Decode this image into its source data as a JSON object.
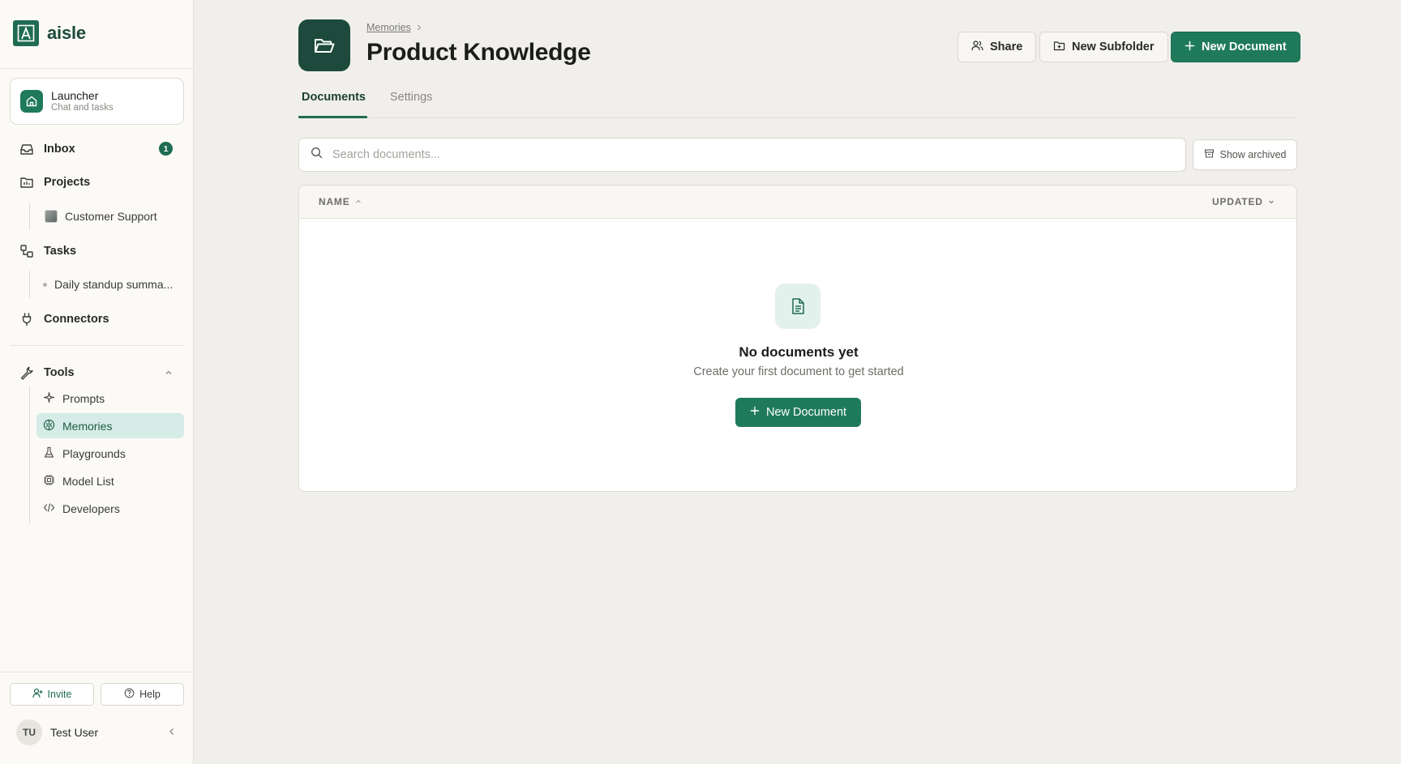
{
  "app": {
    "name": "aisle"
  },
  "sidebar": {
    "launcher": {
      "title": "Launcher",
      "subtitle": "Chat and tasks"
    },
    "inbox": {
      "label": "Inbox",
      "badge": "1"
    },
    "projects": {
      "label": "Projects",
      "items": [
        {
          "label": "Customer Support"
        }
      ]
    },
    "tasks": {
      "label": "Tasks",
      "items": [
        {
          "label": "Daily standup summa..."
        }
      ]
    },
    "connectors": {
      "label": "Connectors"
    },
    "tools": {
      "label": "Tools",
      "items": [
        {
          "label": "Prompts",
          "icon": "sparkle-icon"
        },
        {
          "label": "Memories",
          "icon": "brain-icon",
          "active": true
        },
        {
          "label": "Playgrounds",
          "icon": "flask-icon"
        },
        {
          "label": "Model List",
          "icon": "chip-icon"
        },
        {
          "label": "Developers",
          "icon": "code-icon"
        }
      ]
    },
    "invite_label": "Invite",
    "help_label": "Help",
    "user": {
      "initials": "TU",
      "name": "Test User"
    }
  },
  "header": {
    "breadcrumb": "Memories",
    "title": "Product Knowledge",
    "share_label": "Share",
    "new_subfolder_label": "New Subfolder",
    "new_document_label": "New Document"
  },
  "tabs": [
    {
      "label": "Documents",
      "active": true
    },
    {
      "label": "Settings",
      "active": false
    }
  ],
  "search": {
    "placeholder": "Search documents...",
    "value": ""
  },
  "show_archived_label": "Show archived",
  "table": {
    "columns": [
      {
        "label": "NAME",
        "sort": "asc"
      },
      {
        "label": "UPDATED",
        "sort": "desc"
      }
    ],
    "rows": []
  },
  "empty_state": {
    "title": "No documents yet",
    "subtitle": "Create your first document to get started",
    "button_label": "New Document"
  },
  "colors": {
    "accent": "#1f7a5c",
    "brand_dark": "#1d4a3c",
    "active_bg": "#d6ece6",
    "background": "#f0efeb"
  }
}
